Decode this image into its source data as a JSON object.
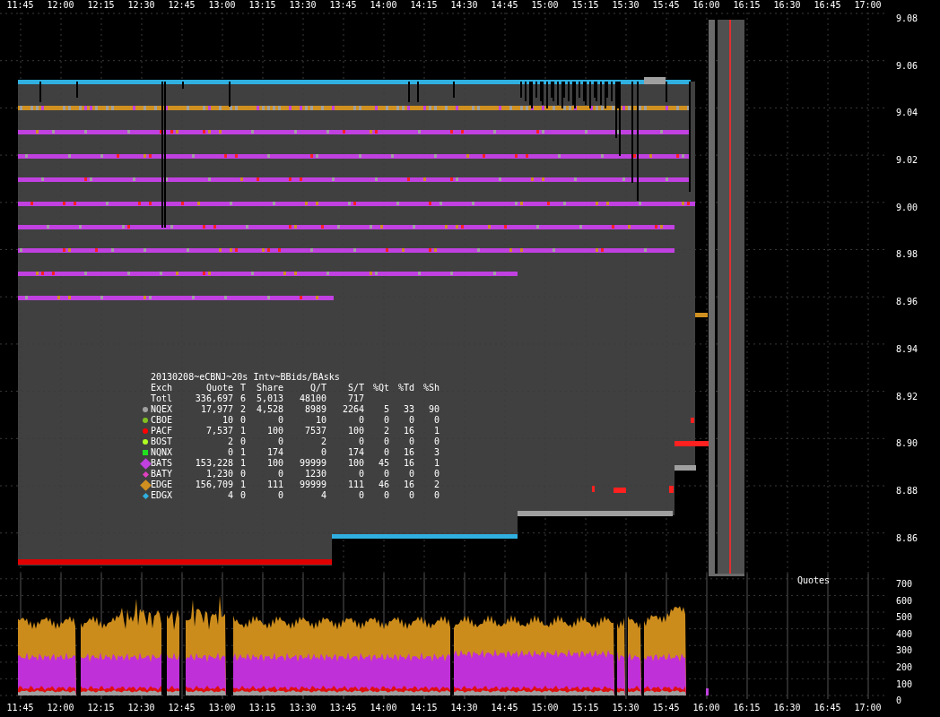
{
  "top_axis": [
    "11:45",
    "12:00",
    "12:15",
    "12:30",
    "12:45",
    "13:00",
    "13:15",
    "13:30",
    "13:45",
    "14:00",
    "14:15",
    "14:30",
    "14:45",
    "15:00",
    "15:15",
    "15:30",
    "15:45",
    "16:00",
    "16:15",
    "16:30",
    "16:45",
    "17:00"
  ],
  "price_axis": [
    "9.08",
    "9.06",
    "9.04",
    "9.02",
    "9.00",
    "8.98",
    "8.96",
    "8.94",
    "8.92",
    "8.90",
    "8.88",
    "8.86"
  ],
  "legend": {
    "title": "20130208~eCBNJ~20s Intv~BBids/BAsks",
    "columns": [
      "Exch",
      "Quote",
      "T",
      "Share",
      "Q/T",
      "S/T",
      "%Qt",
      "%Td",
      "%Sh"
    ],
    "rows": [
      {
        "kind": "total",
        "cells": [
          "Totl",
          "336,697",
          "6",
          "5,013",
          "48100",
          "717"
        ]
      },
      {
        "kind": "dot",
        "color": "#a0a0a0",
        "cells": [
          "NQEX",
          "17,977",
          "2",
          "4,528",
          "8989",
          "2264",
          "5",
          "33",
          "90"
        ]
      },
      {
        "kind": "dot",
        "color": "#80c020",
        "cells": [
          "CBOE",
          "10",
          "0",
          "0",
          "10",
          "0",
          "0",
          "0",
          "0"
        ]
      },
      {
        "kind": "dot",
        "color": "#ff0000",
        "cells": [
          "PACF",
          "7,537",
          "1",
          "100",
          "7537",
          "100",
          "2",
          "16",
          "1"
        ]
      },
      {
        "kind": "dot",
        "color": "#b0ff20",
        "cells": [
          "BOST",
          "2",
          "0",
          "0",
          "2",
          "0",
          "0",
          "0",
          "0"
        ]
      },
      {
        "kind": "square",
        "color": "#20e020",
        "cells": [
          "NQNX",
          "0",
          "1",
          "174",
          "0",
          "174",
          "0",
          "16",
          "3"
        ]
      },
      {
        "kind": "diamond",
        "color": "#c040e0",
        "cells": [
          "BATS",
          "153,228",
          "1",
          "100",
          "99999",
          "100",
          "45",
          "16",
          "1"
        ]
      },
      {
        "kind": "small-diamond",
        "color": "#e040c0",
        "cells": [
          "BATY",
          "1,230",
          "0",
          "0",
          "1230",
          "0",
          "0",
          "0",
          "0"
        ]
      },
      {
        "kind": "diamond",
        "color": "#d09020",
        "cells": [
          "EDGE",
          "156,709",
          "1",
          "111",
          "99999",
          "111",
          "46",
          "16",
          "2"
        ]
      },
      {
        "kind": "small-diamond",
        "color": "#30b0e0",
        "cells": [
          "EDGX",
          "4",
          "0",
          "0",
          "4",
          "0",
          "0",
          "0",
          "0"
        ]
      }
    ]
  },
  "quotes_chart": {
    "label": "Quotes",
    "axis": [
      "700",
      "600",
      "500",
      "400",
      "300",
      "200",
      "100",
      "0"
    ]
  },
  "bottom_axis": [
    "11:45",
    "12:00",
    "12:15",
    "12:30",
    "12:45",
    "13:00",
    "13:15",
    "13:30",
    "13:45",
    "14:00",
    "14:15",
    "14:30",
    "14:45",
    "15:00",
    "15:15",
    "15:30",
    "15:45",
    "16:00",
    "16:15",
    "16:30",
    "16:45",
    "17:00"
  ]
}
